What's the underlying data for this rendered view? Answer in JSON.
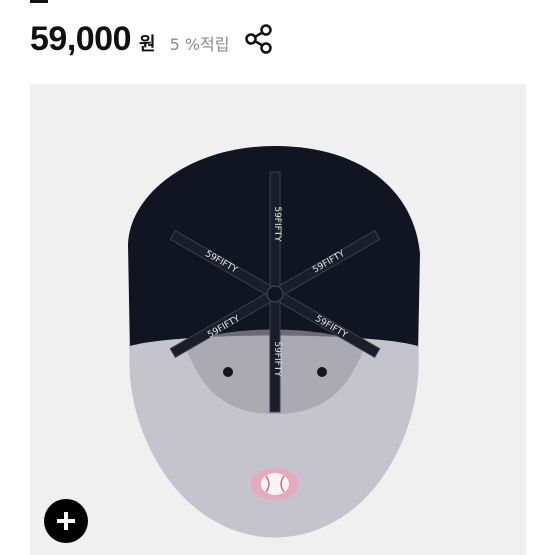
{
  "product": {
    "price": "59,000",
    "currency": "원",
    "points_text": "5 %적립",
    "image": {
      "kind": "fitted baseball cap, underside view",
      "sweatband_tape_text": "59FIFTY",
      "colors": {
        "crown": "#101521",
        "visor_underside": "#c5c3cb",
        "background": "#f0f0f0"
      }
    }
  },
  "actions": {
    "share_icon": "share-icon",
    "zoom_icon": "plus-icon"
  }
}
